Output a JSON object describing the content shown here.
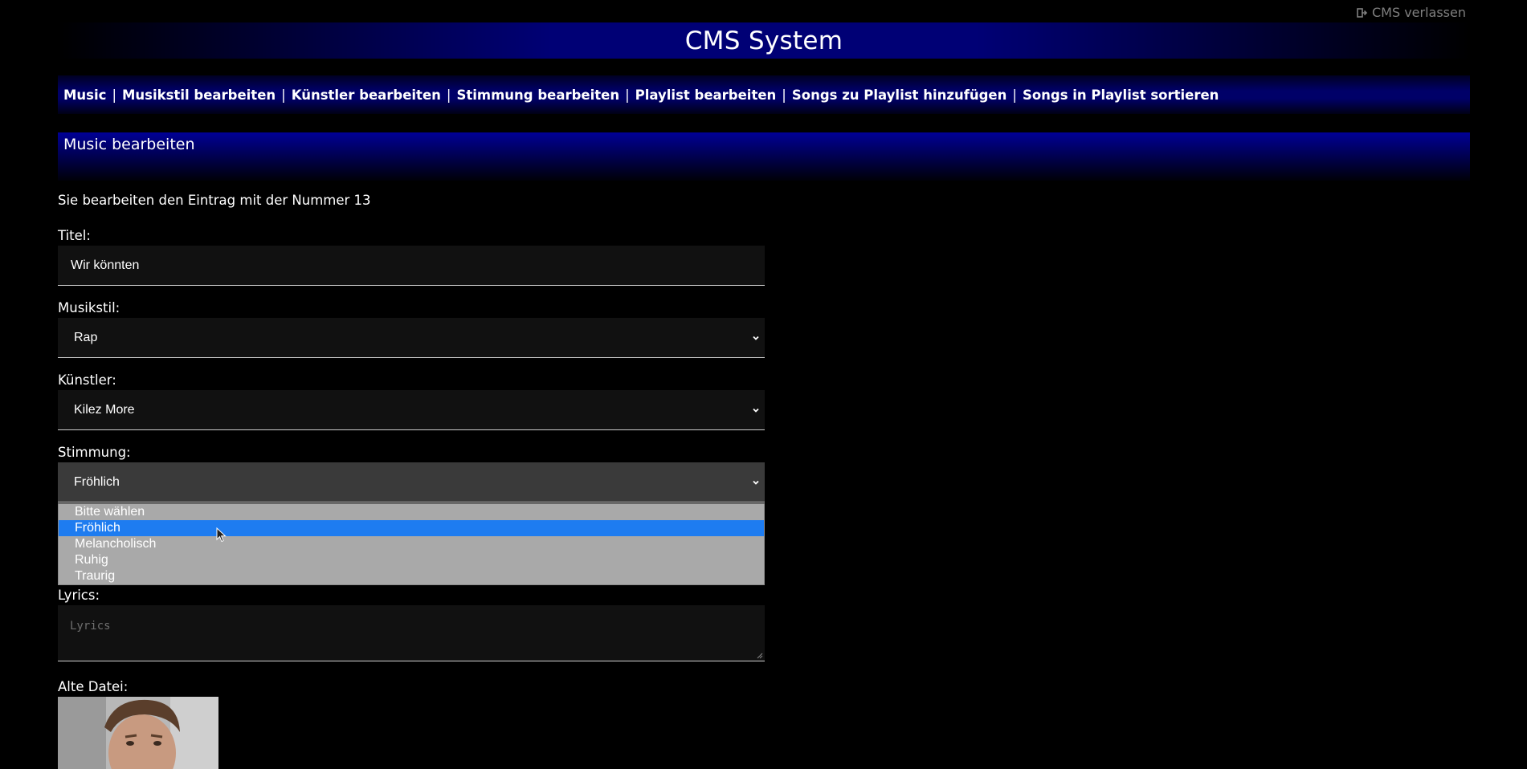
{
  "header": {
    "exit_label": "CMS verlassen",
    "title": "CMS System"
  },
  "nav": {
    "items": [
      "Music",
      "Musikstil bearbeiten",
      "Künstler bearbeiten",
      "Stimmung bearbeiten",
      "Playlist bearbeiten",
      "Songs zu Playlist hinzufügen",
      "Songs in Playlist sortieren"
    ],
    "separator": "|"
  },
  "section": {
    "title": "Music bearbeiten"
  },
  "form": {
    "info": "Sie bearbeiten den Eintrag mit der Nummer 13",
    "titel_label": "Titel:",
    "titel_value": "Wir könnten",
    "musikstil_label": "Musikstil:",
    "musikstil_value": "Rap",
    "kuenstler_label": "Künstler:",
    "kuenstler_value": "Kilez More",
    "stimmung_label": "Stimmung:",
    "stimmung_value": "Fröhlich",
    "stimmung_options": [
      "Bitte wählen",
      "Fröhlich",
      "Melancholisch",
      "Ruhig",
      "Traurig"
    ],
    "stimmung_selected_index": 1,
    "lyrics_label": "Lyrics:",
    "lyrics_placeholder": "Lyrics",
    "alte_datei_label": "Alte Datei:"
  },
  "colors": {
    "header_blue": "#000082",
    "selected_option": "#1e7cf0",
    "dropdown_bg": "#a9a9a9",
    "exit_link": "#7f7f7f"
  },
  "icons": {
    "exit": "sign-out-icon",
    "select_arrow": "chevron-down-icon",
    "cursor": "mouse-pointer-icon"
  }
}
